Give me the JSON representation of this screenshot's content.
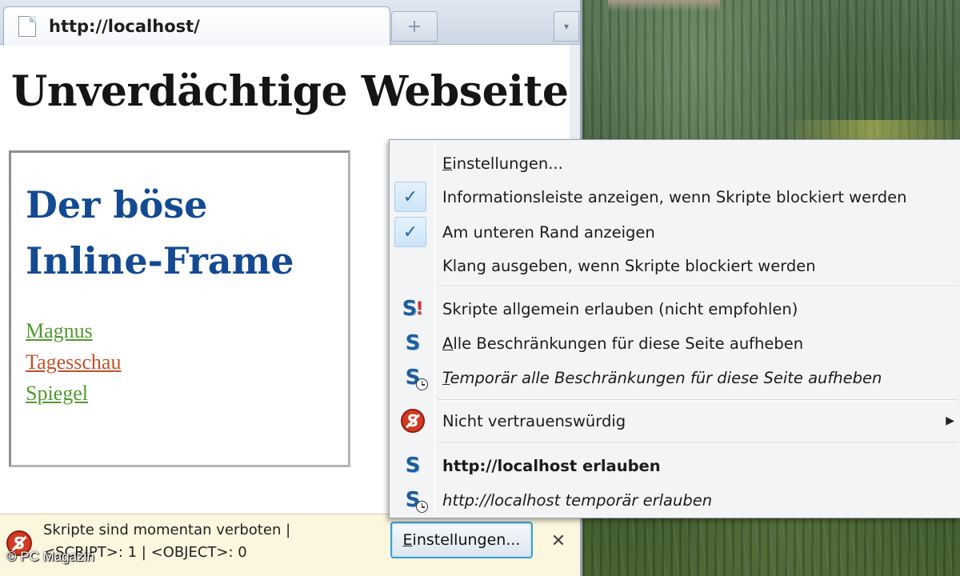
{
  "tab": {
    "title": "http://localhost/",
    "new_tab_symbol": "+",
    "list_symbol": "▾"
  },
  "page": {
    "heading": "Unverdächtige Webseite",
    "iframe": {
      "heading": "Der böse Inline-Frame",
      "links": [
        "Magnus",
        "Tagesschau",
        "Spiegel"
      ],
      "link_colors": [
        "#4f9b2e",
        "#c4502a",
        "#4f9b2e"
      ]
    }
  },
  "infobar": {
    "line1": "Skripte sind momentan verboten |",
    "line2": "<SCRIPT>: 1 | <OBJECT>: 0",
    "button_key": "E",
    "button_rest": "instellungen...",
    "close_symbol": "✕"
  },
  "menu": {
    "items": [
      {
        "key": "E",
        "rest": "instellungen...",
        "icon": "none"
      },
      {
        "label": "Informationsleiste anzeigen, wenn Skripte blockiert werden",
        "checked": true
      },
      {
        "label": "Am unteren Rand anzeigen",
        "checked": true
      },
      {
        "label": "Klang ausgeben, wenn Skripte blockiert werden",
        "checked": false
      },
      {
        "label": "Skripte allgemein erlauben (nicht empfohlen)",
        "icon": "noscript-warning-icon"
      },
      {
        "key": "A",
        "rest": "lle Beschränkungen für diese Seite aufheben",
        "icon": "noscript-icon"
      },
      {
        "key": "T",
        "rest": "emporär alle Beschränkungen für diese Seite aufheben",
        "icon": "noscript-temporary-icon"
      },
      {
        "label": "Nicht vertrauenswürdig",
        "icon": "noscript-forbidden-icon",
        "submenu_symbol": "▶"
      },
      {
        "label": "http://localhost erlauben",
        "icon": "noscript-icon"
      },
      {
        "label": "http://localhost temporär erlauben",
        "icon": "noscript-temporary-icon"
      }
    ],
    "check_symbol": "✓",
    "icon_letter": "S",
    "icon_bang": "!"
  },
  "watermark": "© PC Magazin",
  "colors": {
    "accent": "#3b9ed8",
    "iframe_heading": "#134a92",
    "forbid_red": "#d33a22"
  }
}
